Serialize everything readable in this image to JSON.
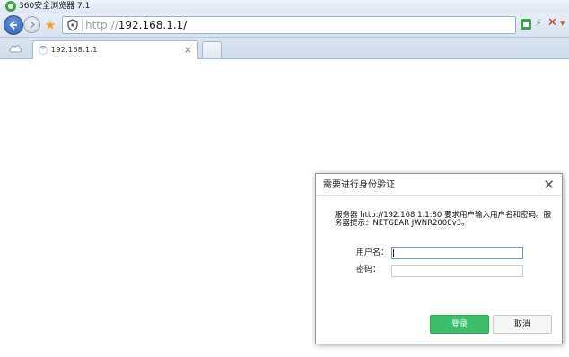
{
  "window": {
    "title": "360安全浏览器 7.1"
  },
  "navbar": {
    "url_prefix": "http://",
    "url_host": "192.168.1.1/"
  },
  "tabs": [
    {
      "label": "192.168.1.1"
    }
  ],
  "dialog": {
    "title": "需要进行身份验证",
    "message": "服务器 http://192.168.1.1:80 要求用户输入用户名和密码。服务器提示：NETGEAR JWNR2000v3。",
    "username_label": "用户名：",
    "password_label": "密码：",
    "username_value": "",
    "password_value": "",
    "login_button": "登录",
    "cancel_button": "取消"
  },
  "colors": {
    "login_button": "#3bbf6b",
    "close_icon": "#d12b2b"
  }
}
